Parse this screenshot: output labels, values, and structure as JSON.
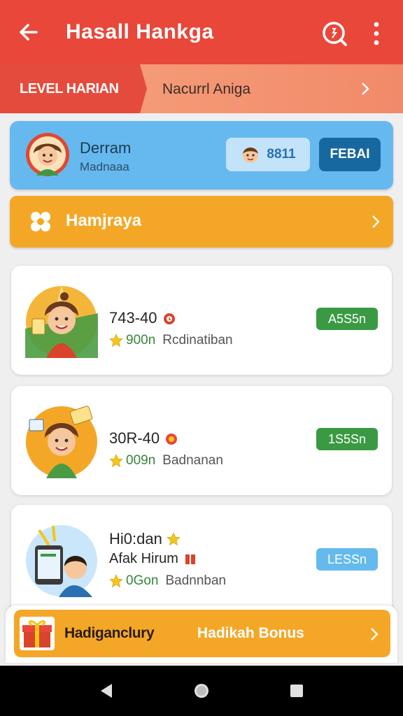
{
  "appbar": {
    "title": "Hasall Hankga",
    "icons": [
      "back-arrow-icon",
      "search-icon",
      "more-vert-icon"
    ]
  },
  "level": {
    "tab_label": "LEVEL HARIAN",
    "subtitle": "Nacurrl Aniga"
  },
  "profile": {
    "name": "Derram",
    "subtitle": "Madnaaa",
    "points": "8811",
    "button_label": "FEBAI",
    "colors": {
      "bg": "#66b9ef",
      "button": "#1768a0"
    }
  },
  "category": {
    "label": "Hamjraya"
  },
  "cards": [
    {
      "line1": "743-40",
      "rating": "900n",
      "word": "Rcdinatiban",
      "badge": "A5S5n",
      "badge_color": "green"
    },
    {
      "line1": "30R-40",
      "rating": "009n",
      "word": "Badnanan",
      "badge": "1S5Sn",
      "badge_color": "green"
    },
    {
      "line1": "Hi0:dan",
      "line2": "Afak Hirum",
      "rating": "0Gon",
      "word": "Badnnban",
      "badge": "LESSn",
      "badge_color": "blue"
    }
  ],
  "bonus": {
    "left_label": "Hadiganclury",
    "right_label": "Hadikah Bonus"
  },
  "accent": "#e8473a"
}
